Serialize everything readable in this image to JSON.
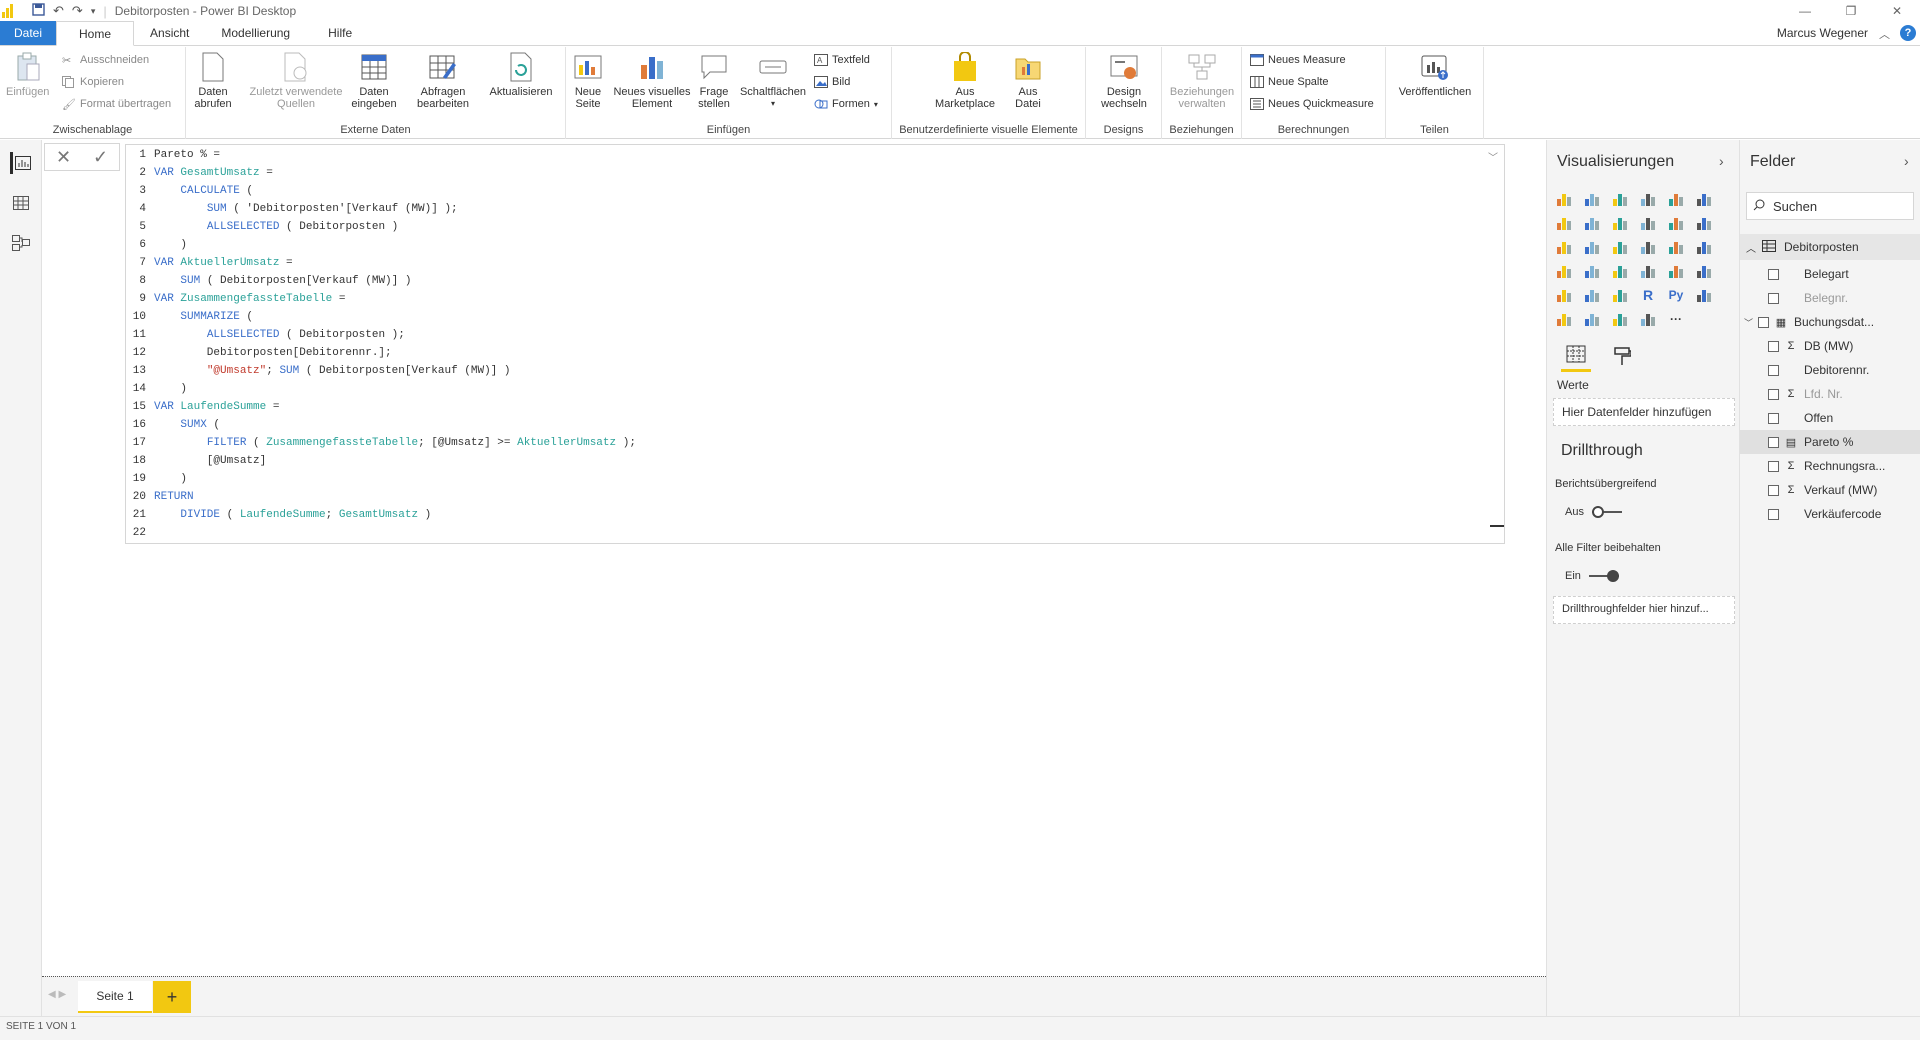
{
  "window": {
    "title": "Debitorposten - Power BI Desktop",
    "user": "Marcus Wegener",
    "help": "?"
  },
  "tabs": [
    {
      "label": "Datei"
    },
    {
      "label": "Home"
    },
    {
      "label": "Ansicht"
    },
    {
      "label": "Modellierung"
    },
    {
      "label": "Hilfe"
    }
  ],
  "ribbon": {
    "clipboard": {
      "label": "Zwischenablage",
      "paste": "Einfügen",
      "cut": "Ausschneiden",
      "copy": "Kopieren",
      "format": "Format übertragen"
    },
    "external": {
      "label": "Externe Daten",
      "get_data": "Daten\nabrufen",
      "recent": "Zuletzt verwendete\nQuellen",
      "enter": "Daten\neingeben",
      "edit_queries": "Abfragen\nbearbeiten",
      "refresh": "Aktualisieren"
    },
    "insert": {
      "label": "Einfügen",
      "new_page": "Neue\nSeite",
      "new_visual": "Neues visuelles\nElement",
      "ask": "Frage\nstellen",
      "buttons": "Schaltflächen",
      "textbox": "Textfeld",
      "image": "Bild",
      "shapes": "Formen"
    },
    "custom_visuals": {
      "label": "Benutzerdefinierte visuelle Elemente",
      "marketplace": "Aus\nMarketplace",
      "from_file": "Aus\nDatei"
    },
    "designs": {
      "label": "Designs",
      "switch": "Design\nwechseln"
    },
    "relations": {
      "label": "Beziehungen",
      "manage": "Beziehungen\nverwalten"
    },
    "calculations": {
      "label": "Berechnungen",
      "new_measure": "Neues Measure",
      "new_column": "Neue Spalte",
      "new_quick": "Neues Quickmeasure"
    },
    "share": {
      "label": "Teilen",
      "publish": "Veröffentlichen"
    }
  },
  "editor": {
    "lines": [
      [
        {
          "t": "Pareto % ="
        }
      ],
      [
        {
          "t": "VAR ",
          "c": "kw"
        },
        {
          "t": "GesamtUmsatz",
          "c": "vr"
        },
        {
          "t": " ="
        }
      ],
      [
        {
          "t": "    "
        },
        {
          "t": "CALCULATE",
          "c": "fn"
        },
        {
          "t": " ("
        }
      ],
      [
        {
          "t": "        "
        },
        {
          "t": "SUM",
          "c": "fn"
        },
        {
          "t": " ( 'Debitorposten'[Verkauf (MW)] );"
        }
      ],
      [
        {
          "t": "        "
        },
        {
          "t": "ALLSELECTED",
          "c": "fn"
        },
        {
          "t": " ( Debitorposten )"
        }
      ],
      [
        {
          "t": "    )"
        }
      ],
      [
        {
          "t": "VAR ",
          "c": "kw"
        },
        {
          "t": "AktuellerUmsatz",
          "c": "vr"
        },
        {
          "t": " ="
        }
      ],
      [
        {
          "t": "    "
        },
        {
          "t": "SUM",
          "c": "fn"
        },
        {
          "t": " ( Debitorposten[Verkauf (MW)] )"
        }
      ],
      [
        {
          "t": "VAR ",
          "c": "kw"
        },
        {
          "t": "ZusammengefassteTabelle",
          "c": "vr"
        },
        {
          "t": " ="
        }
      ],
      [
        {
          "t": "    "
        },
        {
          "t": "SUMMARIZE",
          "c": "fn"
        },
        {
          "t": " ("
        }
      ],
      [
        {
          "t": "        "
        },
        {
          "t": "ALLSELECTED",
          "c": "fn"
        },
        {
          "t": " ( Debitorposten );"
        }
      ],
      [
        {
          "t": "        Debitorposten[Debitorennr.];"
        }
      ],
      [
        {
          "t": "        "
        },
        {
          "t": "\"@Umsatz\"",
          "c": "st"
        },
        {
          "t": "; "
        },
        {
          "t": "SUM",
          "c": "fn"
        },
        {
          "t": " ( Debitorposten[Verkauf (MW)] )"
        }
      ],
      [
        {
          "t": "    )"
        }
      ],
      [
        {
          "t": "VAR ",
          "c": "kw"
        },
        {
          "t": "LaufendeSumme",
          "c": "vr"
        },
        {
          "t": " ="
        }
      ],
      [
        {
          "t": "    "
        },
        {
          "t": "SUMX",
          "c": "fn"
        },
        {
          "t": " ("
        }
      ],
      [
        {
          "t": "        "
        },
        {
          "t": "FILTER",
          "c": "fn"
        },
        {
          "t": " ( "
        },
        {
          "t": "ZusammengefassteTabelle",
          "c": "vr"
        },
        {
          "t": "; [@Umsatz] >= "
        },
        {
          "t": "AktuellerUmsatz",
          "c": "vr"
        },
        {
          "t": " );"
        }
      ],
      [
        {
          "t": "        [@Umsatz]"
        }
      ],
      [
        {
          "t": "    )"
        }
      ],
      [
        {
          "t": "RETURN",
          "c": "kw"
        }
      ],
      [
        {
          "t": "    "
        },
        {
          "t": "DIVIDE",
          "c": "fn"
        },
        {
          "t": " ( "
        },
        {
          "t": "LaufendeSumme",
          "c": "vr"
        },
        {
          "t": "; "
        },
        {
          "t": "GesamtUmsatz",
          "c": "vr"
        },
        {
          "t": " )"
        }
      ],
      [
        {
          "t": ""
        }
      ]
    ]
  },
  "pages": {
    "current": "Seite 1",
    "add": "+",
    "status": "SEITE 1 VON 1"
  },
  "viz": {
    "title": "Visualisierungen",
    "values_label": "Werte",
    "values_placeholder": "Hier Datenfelder hinzufügen",
    "drill_title": "Drillthrough",
    "cross_report": "Berichtsübergreifend",
    "cross_report_state": "Aus",
    "keep_filters": "Alle Filter beibehalten",
    "keep_filters_state": "Ein",
    "drill_placeholder": "Drillthroughfelder hier hinzuf...",
    "more": "···",
    "r_icon": "R",
    "py_icon": "Py"
  },
  "fields": {
    "title": "Felder",
    "search_placeholder": "Suchen",
    "table": "Debitorposten",
    "items": [
      {
        "label": "Belegart",
        "icon": "",
        "dim": false,
        "sel": false,
        "expand": false
      },
      {
        "label": "Belegnr.",
        "icon": "",
        "dim": true,
        "sel": false,
        "expand": false
      },
      {
        "label": "Buchungsdat...",
        "icon": "▦",
        "dim": false,
        "sel": false,
        "expand": true
      },
      {
        "label": "DB (MW)",
        "icon": "Σ",
        "dim": false,
        "sel": false,
        "expand": false
      },
      {
        "label": "Debitorennr.",
        "icon": "",
        "dim": false,
        "sel": false,
        "expand": false
      },
      {
        "label": "Lfd. Nr.",
        "icon": "Σ",
        "dim": true,
        "sel": false,
        "expand": false
      },
      {
        "label": "Offen",
        "icon": "",
        "dim": false,
        "sel": false,
        "expand": false
      },
      {
        "label": "Pareto %",
        "icon": "▤",
        "dim": false,
        "sel": true,
        "expand": false
      },
      {
        "label": "Rechnungsra...",
        "icon": "Σ",
        "dim": false,
        "sel": false,
        "expand": false
      },
      {
        "label": "Verkauf (MW)",
        "icon": "Σ",
        "dim": false,
        "sel": false,
        "expand": false
      },
      {
        "label": "Verkäufercode",
        "icon": "",
        "dim": false,
        "sel": false,
        "expand": false
      }
    ]
  },
  "colors": {
    "accent": "#f2c811",
    "file_tab": "#2b7cd3",
    "keyword": "#3a6ec9",
    "variable": "#2aa198",
    "string": "#c0392b"
  }
}
